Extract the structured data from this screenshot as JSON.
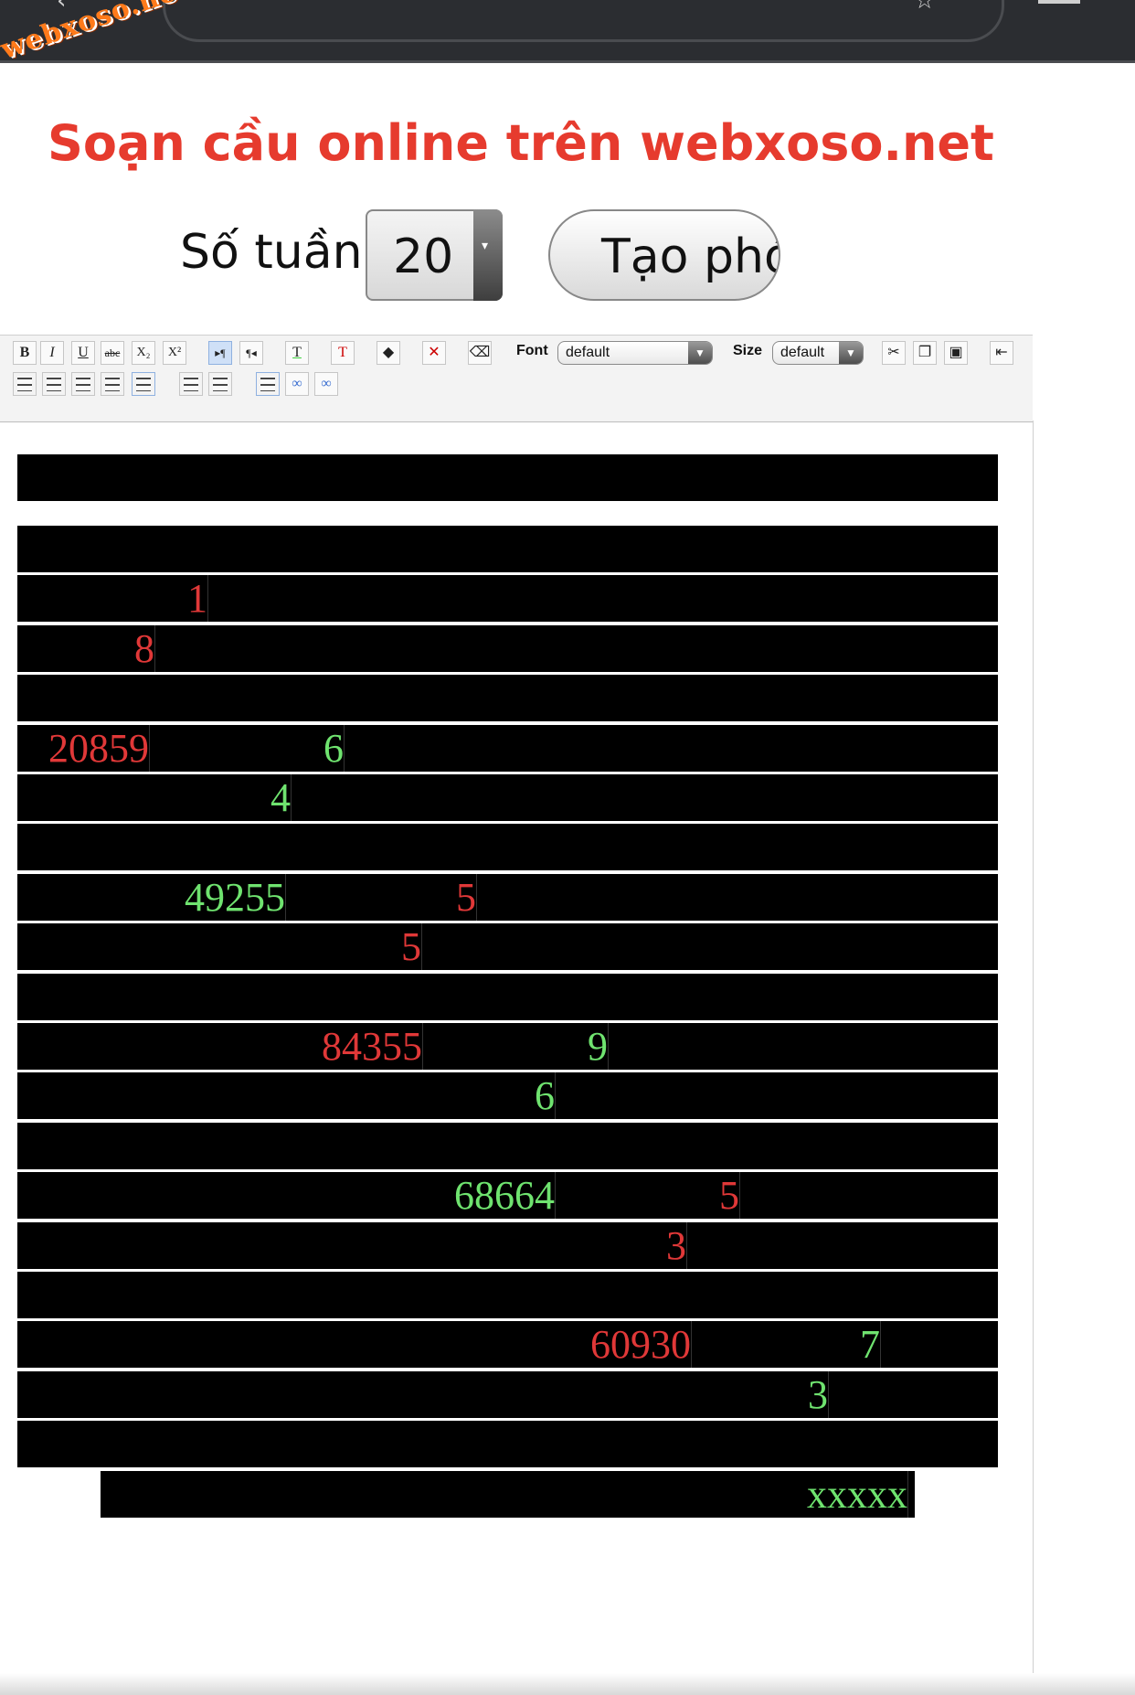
{
  "browser": {
    "back_icon": "chevron-left-icon",
    "star_icon": "star-icon",
    "menu_icon": "menu-icon"
  },
  "logo": {
    "text": "webxoso.net"
  },
  "page": {
    "title": "Soạn cầu online trên webxoso.net"
  },
  "controls": {
    "weeks_label": "Số tuần",
    "weeks_value": "20",
    "make_button": "Tạo phó"
  },
  "toolbar": {
    "font_label": "Font",
    "font_value": "default",
    "size_label": "Size",
    "size_value": "default",
    "buttons_row1": [
      "B",
      "I",
      "U",
      "abc",
      "X₂",
      "X²",
      "▸¶",
      "¶◂",
      "T",
      "T"
    ],
    "buttons_row2": [
      "left",
      "center",
      "right",
      "justify"
    ]
  },
  "colors": {
    "red": "#e03838",
    "green": "#6fe36f",
    "title": "#e63b2e",
    "logo": "#ff7a1a"
  },
  "grid": {
    "rows": [
      [],
      [
        {
          "text": "1",
          "color": "red"
        }
      ],
      [
        {
          "text": "8",
          "color": "red"
        }
      ],
      [],
      [
        {
          "text": "20859",
          "color": "red"
        },
        {
          "text": "6",
          "color": "green"
        }
      ],
      [
        {
          "text": "4",
          "color": "green"
        }
      ],
      [],
      [
        {
          "text": "49255",
          "color": "green"
        },
        {
          "text": "5",
          "color": "red"
        }
      ],
      [
        {
          "text": "5",
          "color": "red"
        }
      ],
      [],
      [
        {
          "text": "84355",
          "color": "red"
        },
        {
          "text": "9",
          "color": "green"
        }
      ],
      [
        {
          "text": "6",
          "color": "green"
        }
      ],
      [],
      [
        {
          "text": "68664",
          "color": "green"
        },
        {
          "text": "5",
          "color": "red"
        }
      ],
      [
        {
          "text": "3",
          "color": "red"
        }
      ],
      [],
      [
        {
          "text": "60930",
          "color": "red"
        },
        {
          "text": "7",
          "color": "green"
        }
      ],
      [
        {
          "text": "3",
          "color": "green"
        }
      ],
      [],
      [
        {
          "text": "xxxxx",
          "color": "green"
        }
      ]
    ]
  }
}
